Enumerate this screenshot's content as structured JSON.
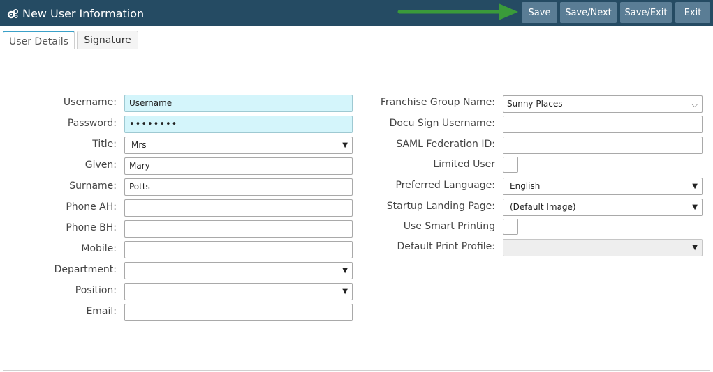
{
  "header": {
    "title": "New User Information",
    "icon": "gears-icon",
    "buttons": {
      "save": "Save",
      "save_next": "Save/Next",
      "save_exit": "Save/Exit",
      "exit": "Exit"
    },
    "accent_color": "#254b63",
    "button_color": "#5a7d95"
  },
  "tabs": {
    "user_details": "User Details",
    "signature": "Signature"
  },
  "left": {
    "username": {
      "label": "Username:",
      "value": "Username"
    },
    "password": {
      "label": "Password:",
      "value": "••••••••"
    },
    "title": {
      "label": "Title:",
      "value": "Mrs"
    },
    "given": {
      "label": "Given:",
      "value": "Mary"
    },
    "surname": {
      "label": "Surname:",
      "value": "Potts"
    },
    "phone_ah": {
      "label": "Phone AH:",
      "value": ""
    },
    "phone_bh": {
      "label": "Phone BH:",
      "value": ""
    },
    "mobile": {
      "label": "Mobile:",
      "value": ""
    },
    "department": {
      "label": "Department:",
      "value": ""
    },
    "position": {
      "label": "Position:",
      "value": ""
    },
    "email": {
      "label": "Email:",
      "value": ""
    }
  },
  "right": {
    "franchise": {
      "label": "Franchise Group Name:",
      "value": "Sunny Places"
    },
    "docusign": {
      "label": "Docu Sign Username:",
      "value": ""
    },
    "saml": {
      "label": "SAML Federation ID:",
      "value": ""
    },
    "limited_user": {
      "label": "Limited User",
      "checked": false
    },
    "language": {
      "label": "Preferred Language:",
      "value": "English"
    },
    "landing": {
      "label": "Startup Landing Page:",
      "value": "(Default Image)"
    },
    "smart_printing": {
      "label": "Use Smart Printing",
      "checked": false
    },
    "print_profile": {
      "label": "Default Print Profile:",
      "value": ""
    }
  }
}
